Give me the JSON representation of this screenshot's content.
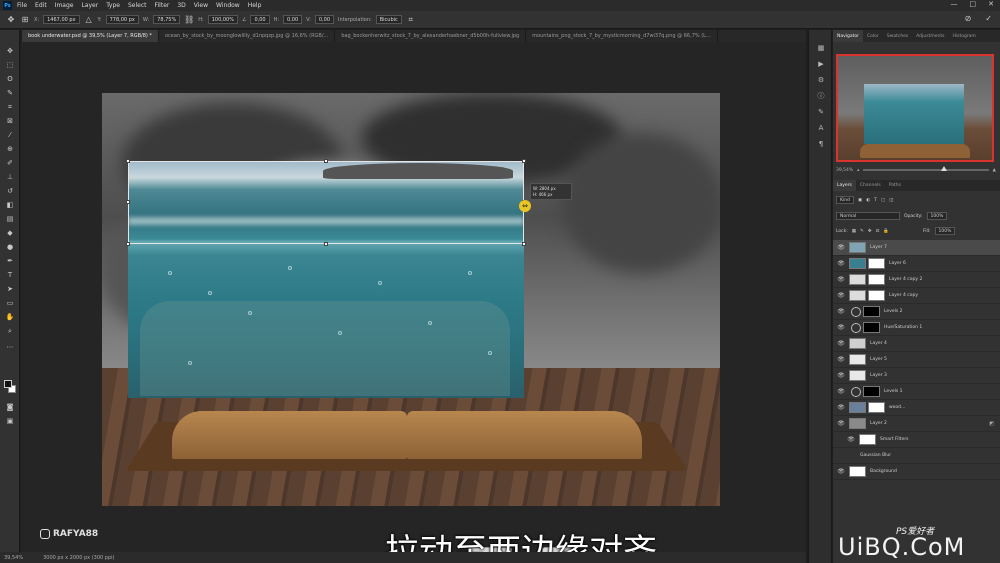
{
  "menu": {
    "app_badge": "Ps",
    "items": [
      "File",
      "Edit",
      "Image",
      "Layer",
      "Type",
      "Select",
      "Filter",
      "3D",
      "View",
      "Window",
      "Help"
    ]
  },
  "window_controls": {
    "minimize": "—",
    "maximize": "□",
    "close": "✕"
  },
  "options": {
    "x_label": "X:",
    "x_value": "1467,00 px",
    "y_label": "Y:",
    "y_value": "778,00 px",
    "w_label": "W:",
    "w_value": "78,75%",
    "h_label": "H:",
    "h_value": "100,00%",
    "angle_label": "∠",
    "angle_value": "0,00",
    "hskew_label": "H:",
    "hskew_value": "0,00",
    "vskew_label": "V:",
    "vskew_value": "0,00",
    "interp_label": "Interpolation:",
    "interp_value": "Bicubic",
    "cancel_glyph": "⊘",
    "commit_glyph": "✓"
  },
  "tabs": [
    {
      "label": "book underwater.psd @ 39,5% (Layer 7, RGB/8) *",
      "active": true
    },
    {
      "label": "ocean_by_stock_by_moonglowlilly_d1npqzp.jpg @ 16,6% (RGB/..."
    },
    {
      "label": "bag_bockenherwitz_stock_7_by_alexanderhaebner_d5b00h-fullview.jpg"
    },
    {
      "label": "mountains_png_stock_7_by_mysticmorning_d7wi37q.png @ 66,7% (L..."
    }
  ],
  "canvas": {
    "readout_w": "W: 2804 px",
    "readout_h": "H: 466 px",
    "cursor_glyph": "⇔",
    "subtitle": "拉动至两边缘对齐",
    "key_label": "Ctrl",
    "watermark": "RAFYA88"
  },
  "status": {
    "zoom": "39,54%",
    "doc": "3000 px x 2000 px (300 ppi)"
  },
  "panels": {
    "top_tabs": [
      "Navigator",
      "Color",
      "Swatches",
      "Adjustments",
      "Histogram"
    ],
    "nav_zoom": "39,54%",
    "layer_tabs": [
      "Layers",
      "Channels",
      "Paths"
    ],
    "filter_kind": "Kind",
    "blend_mode": "Normal",
    "opacity_label": "Opacity:",
    "opacity_value": "100%",
    "lock_label": "Lock:",
    "fill_label": "Fill:",
    "fill_value": "100%"
  },
  "layers": [
    {
      "name": "Layer 7",
      "selected": true,
      "kind": "pixel",
      "color": "#7fa5b5"
    },
    {
      "name": "Layer 6",
      "kind": "pixel-mask",
      "color": "#3a7f90"
    },
    {
      "name": "Layer 4 copy 2",
      "kind": "pixel-mask",
      "color": "#dcdcdc"
    },
    {
      "name": "Layer 4 copy",
      "kind": "pixel-mask",
      "color": "#dcdcdc"
    },
    {
      "name": "Levels 2",
      "kind": "adjustment"
    },
    {
      "name": "Hue/Saturation 1",
      "kind": "adjustment"
    },
    {
      "name": "Layer 4",
      "kind": "pixel",
      "color": "#cfcfcf"
    },
    {
      "name": "Layer 5",
      "kind": "pixel",
      "color": "#e8e8e8"
    },
    {
      "name": "Layer 3",
      "kind": "pixel",
      "color": "#e8e8e8"
    },
    {
      "name": "Levels 1",
      "kind": "adjustment"
    },
    {
      "name": "wood...",
      "kind": "pixel-mask",
      "color": "#6a7f9a"
    },
    {
      "name": "Layer 2",
      "kind": "pixel",
      "color": "#8a8a8a"
    },
    {
      "name": "Smart Filters",
      "kind": "sub",
      "color": "#ffffff"
    },
    {
      "name": "Gaussian Blur",
      "kind": "subitem"
    },
    {
      "name": "Background",
      "kind": "pixel",
      "color": "#ffffff"
    }
  ],
  "brand": {
    "text": "UiBQ.CoM",
    "ps": "PS爱好者"
  }
}
